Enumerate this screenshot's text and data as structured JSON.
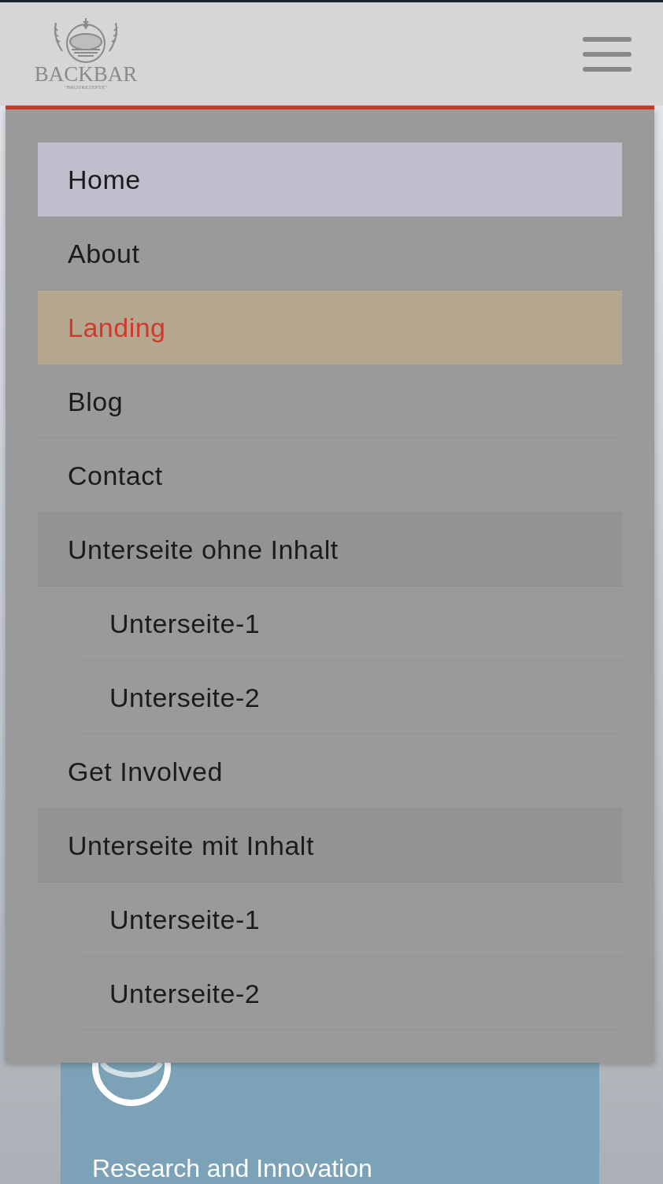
{
  "header": {
    "logo": {
      "name": "BACKBAR",
      "tagline": "\"BROTREZEPTE\""
    }
  },
  "menu": {
    "items": [
      {
        "label": "Home",
        "hovered": true,
        "selected": false
      },
      {
        "label": "About",
        "hovered": false,
        "selected": false
      },
      {
        "label": "Landing",
        "hovered": false,
        "selected": true
      },
      {
        "label": "Blog",
        "hovered": false,
        "selected": false
      },
      {
        "label": "Contact",
        "hovered": false,
        "selected": false
      },
      {
        "label": "Unterseite ohne Inhalt",
        "hovered": false,
        "selected": false,
        "children": [
          {
            "label": "Unterseite-1",
            "hovered": false,
            "selected": false
          },
          {
            "label": "Unterseite-2",
            "hovered": false,
            "selected": false
          }
        ]
      },
      {
        "label": "Get Involved",
        "hovered": false,
        "selected": false
      },
      {
        "label": "Unterseite mit Inhalt",
        "hovered": false,
        "selected": false,
        "children": [
          {
            "label": "Unterseite-1",
            "hovered": false,
            "selected": false
          },
          {
            "label": "Unterseite-2",
            "hovered": false,
            "selected": false
          }
        ]
      }
    ]
  },
  "card": {
    "title": "Research and Innovation"
  }
}
